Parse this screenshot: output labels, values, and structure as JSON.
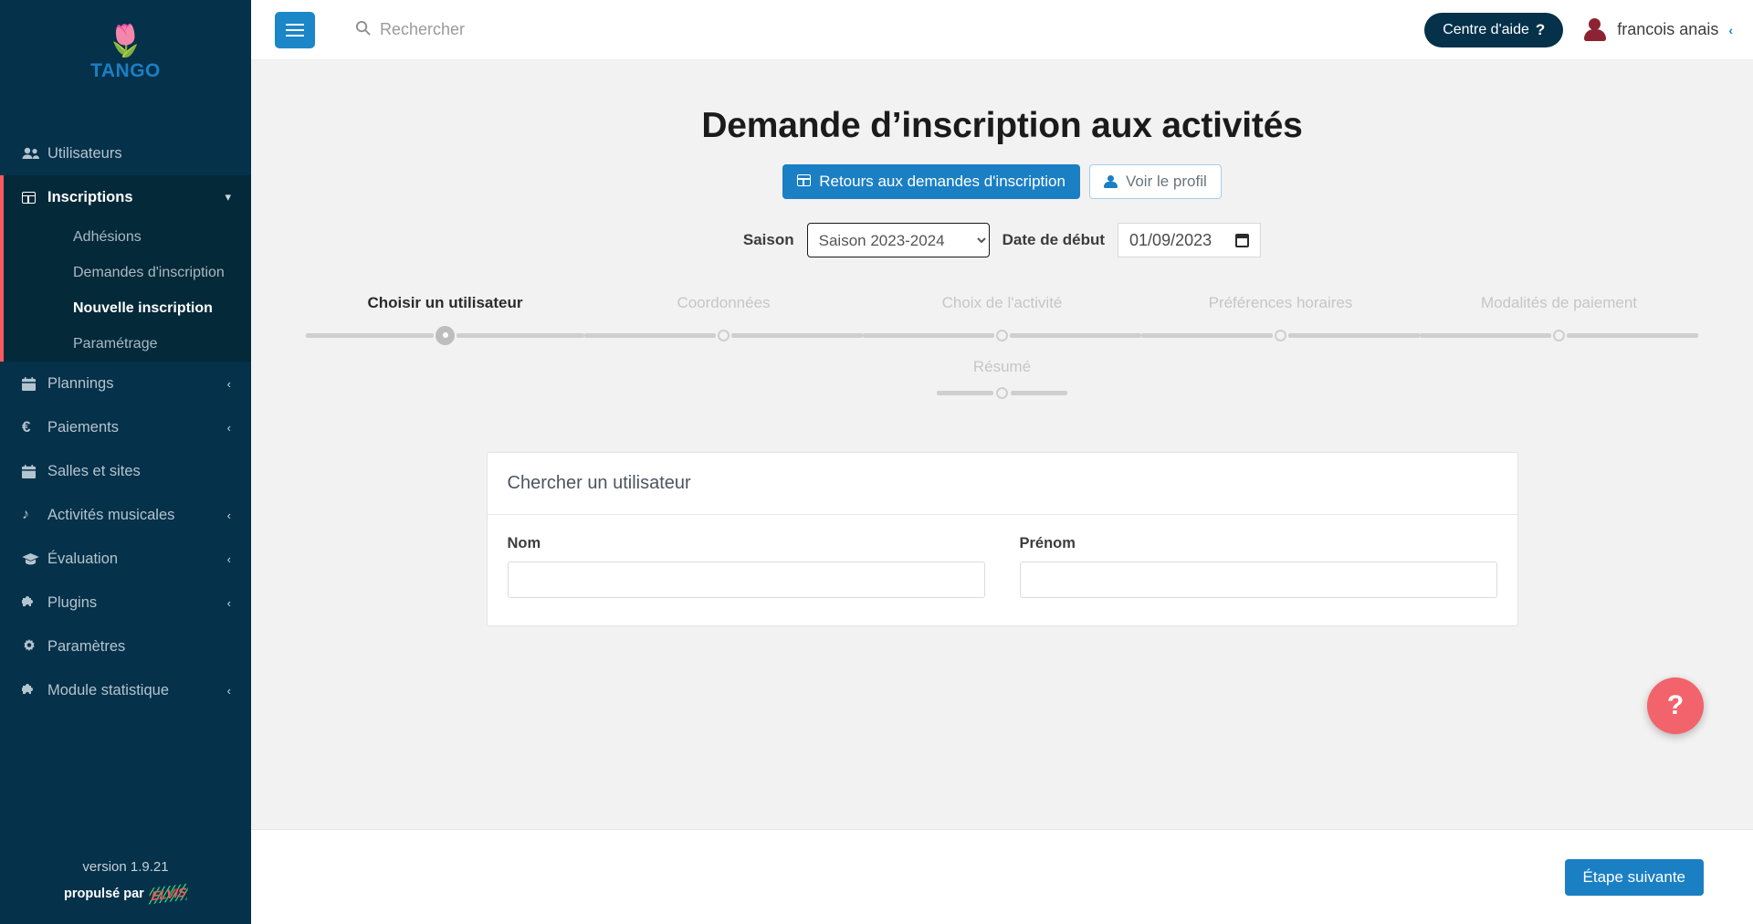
{
  "brand": {
    "logo_icon": "tulip-icon",
    "logo_glyph": "🌷",
    "name": "TANGO"
  },
  "sidebar": {
    "items": [
      {
        "label": "Utilisateurs",
        "icon": "users-icon",
        "glyph": "\u0000",
        "caret": ""
      },
      {
        "label": "Inscriptions",
        "icon": "grid-icon",
        "caret": "⌄"
      },
      {
        "label": "Plannings",
        "icon": "calendar-icon",
        "caret": "‹"
      },
      {
        "label": "Paiements",
        "icon": "euro-icon",
        "caret": "‹"
      },
      {
        "label": "Salles et sites",
        "icon": "calendar-icon",
        "caret": ""
      },
      {
        "label": "Activités musicales",
        "icon": "music-note-icon",
        "caret": "‹"
      },
      {
        "label": "Évaluation",
        "icon": "graduation-cap-icon",
        "caret": "‹"
      },
      {
        "label": "Plugins",
        "icon": "puzzle-icon",
        "caret": "‹"
      },
      {
        "label": "Paramètres",
        "icon": "gear-icon",
        "caret": ""
      },
      {
        "label": "Module statistique",
        "icon": "puzzle-icon",
        "caret": "‹"
      }
    ],
    "subitems": [
      {
        "label": "Adhésions",
        "active": false
      },
      {
        "label": "Demandes d'inscription",
        "active": false
      },
      {
        "label": "Nouvelle inscription",
        "active": true
      },
      {
        "label": "Paramétrage",
        "active": false
      }
    ],
    "footer": {
      "version": "version 1.9.21",
      "powered_by": "propulsé par",
      "powered_brand": "ELVIS"
    },
    "accent_active": "#ff5a5f",
    "background": "#05314a"
  },
  "topbar": {
    "menu_toggle_icon": "hamburger-icon",
    "search": {
      "icon": "search-icon",
      "placeholder": "Rechercher",
      "value": ""
    },
    "help_center": {
      "label": "Centre d'aide",
      "suffix": "?"
    },
    "user": {
      "name": "francois anais",
      "avatar_icon": "user-avatar-icon",
      "caret": "‹"
    }
  },
  "page": {
    "title": "Demande d’inscription aux activités",
    "actions": [
      {
        "label": "Retours aux demandes d'inscription",
        "icon": "grid-icon",
        "style": "primary"
      },
      {
        "label": "Voir le profil",
        "icon": "person-icon",
        "style": "outline"
      }
    ],
    "filters": {
      "season_label": "Saison",
      "season_value": "Saison 2023-2024",
      "season_options": [
        "Saison 2023-2024"
      ],
      "date_label": "Date de début",
      "date_value": "01/09/2023",
      "date_icon": "calendar-icon"
    },
    "stepper": {
      "row1": [
        {
          "label": "Choisir un utilisateur",
          "active": true
        },
        {
          "label": "Coordonnées",
          "active": false
        },
        {
          "label": "Choix de l'activité",
          "active": false
        },
        {
          "label": "Préférences horaires",
          "active": false
        },
        {
          "label": "Modalités de paiement",
          "active": false
        }
      ],
      "row2": {
        "label": "Résumé",
        "active": false
      }
    },
    "card": {
      "title": "Chercher un utilisateur",
      "fields": [
        {
          "label": "Nom",
          "value": "",
          "placeholder": ""
        },
        {
          "label": "Prénom",
          "value": "",
          "placeholder": ""
        }
      ]
    },
    "fab": {
      "icon": "question-mark-icon",
      "label": "?"
    },
    "next_button": {
      "label": "Étape suivante"
    }
  }
}
